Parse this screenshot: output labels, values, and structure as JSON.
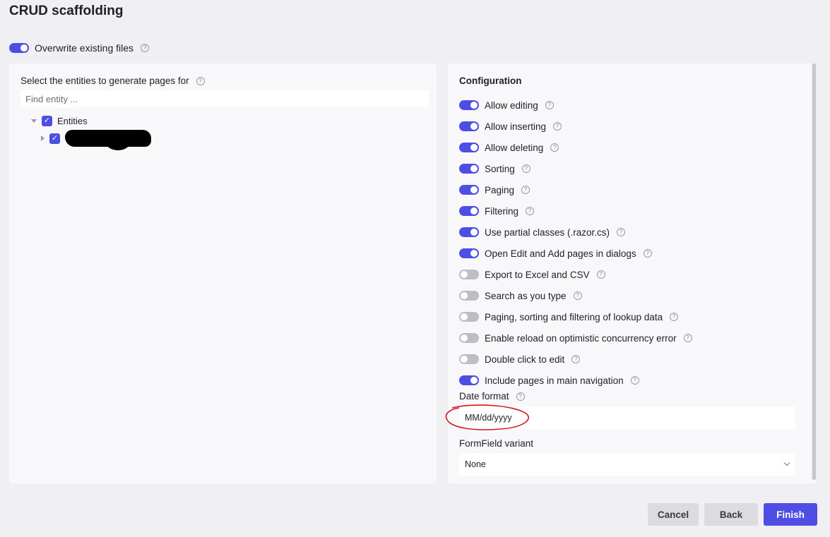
{
  "title": "CRUD scaffolding",
  "overwrite": {
    "label": "Overwrite existing files",
    "enabled": true
  },
  "entities": {
    "label": "Select the entities to generate pages for",
    "search_placeholder": "Find entity ...",
    "tree": [
      {
        "label": "Entities",
        "checked": true
      }
    ]
  },
  "config": {
    "title": "Configuration",
    "options": [
      {
        "label": "Allow editing",
        "enabled": true
      },
      {
        "label": "Allow inserting",
        "enabled": true
      },
      {
        "label": "Allow deleting",
        "enabled": true
      },
      {
        "label": "Sorting",
        "enabled": true
      },
      {
        "label": "Paging",
        "enabled": true
      },
      {
        "label": "Filtering",
        "enabled": true
      },
      {
        "label": "Use partial classes (.razor.cs)",
        "enabled": true
      },
      {
        "label": "Open Edit and Add pages in dialogs",
        "enabled": true
      },
      {
        "label": "Export to Excel and CSV",
        "enabled": false
      },
      {
        "label": "Search as you type",
        "enabled": false
      },
      {
        "label": "Paging, sorting and filtering of lookup data",
        "enabled": false
      },
      {
        "label": "Enable reload on optimistic concurrency error",
        "enabled": false
      },
      {
        "label": "Double click to edit",
        "enabled": false
      },
      {
        "label": "Include pages in main navigation",
        "enabled": true
      }
    ],
    "date_format": {
      "label": "Date format",
      "value": "MM/dd/yyyy"
    },
    "formfield_variant": {
      "label": "FormField variant",
      "value": "None"
    }
  },
  "buttons": {
    "cancel": "Cancel",
    "back": "Back",
    "finish": "Finish"
  },
  "colors": {
    "accent": "#4f4ee4",
    "toggle_off": "#bdbdc3",
    "annotation": "#d7191c"
  }
}
